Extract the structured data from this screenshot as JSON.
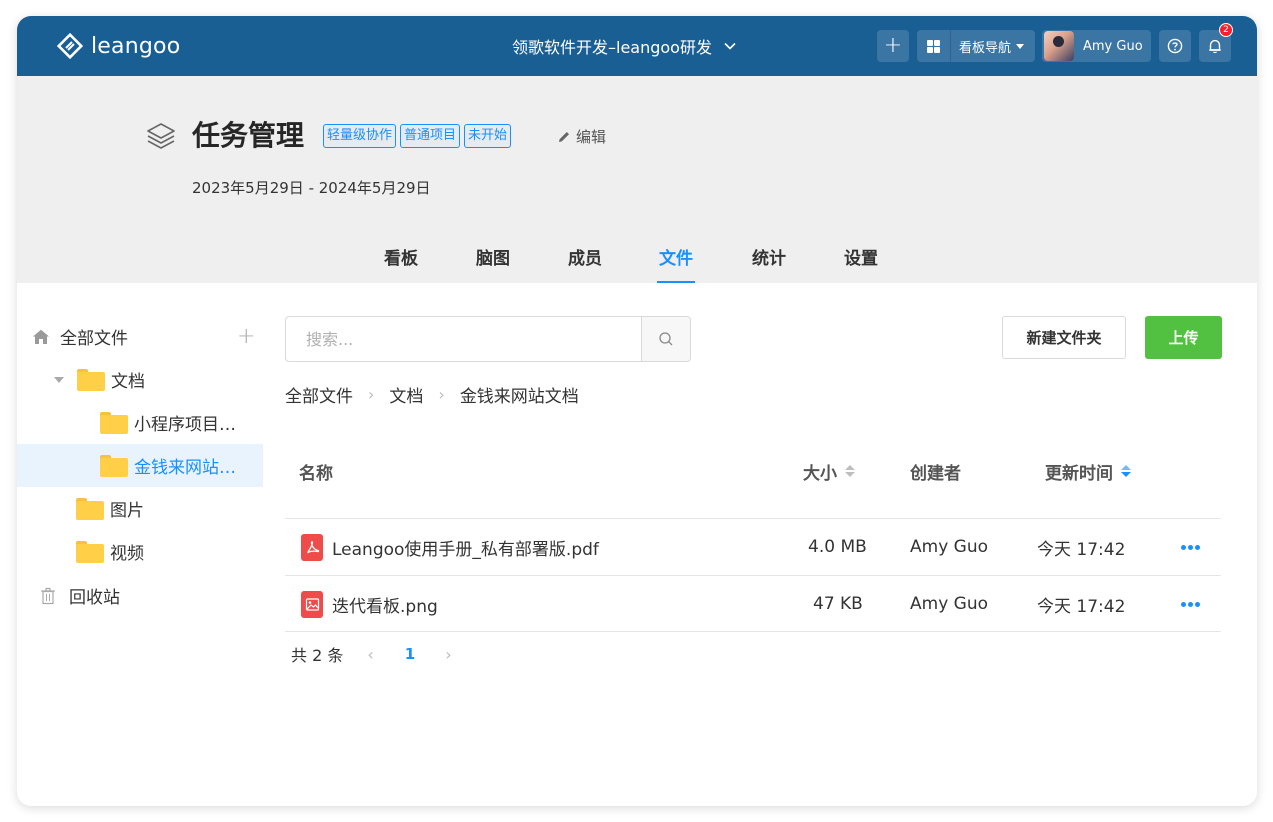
{
  "app": {
    "logo_text": "leangoo"
  },
  "topbar": {
    "project_title": "领歌软件开发–leangoo研发",
    "board_nav_label": "看板导航",
    "user_name": "Amy Guo",
    "notification_count": "2"
  },
  "project": {
    "title": "任务管理",
    "tags": [
      "轻量级协作",
      "普通项目",
      "未开始"
    ],
    "edit_label": "编辑",
    "date_range": "2023年5月29日 - 2024年5月29日"
  },
  "tabs": [
    {
      "label": "看板"
    },
    {
      "label": "脑图"
    },
    {
      "label": "成员"
    },
    {
      "label": "文件",
      "active": true
    },
    {
      "label": "统计"
    },
    {
      "label": "设置"
    }
  ],
  "sidebar": {
    "items": [
      {
        "label": "全部文件"
      },
      {
        "label": "文档"
      },
      {
        "label": "小程序项目…"
      },
      {
        "label": "金钱来网站…",
        "active": true
      },
      {
        "label": "图片"
      },
      {
        "label": "视频"
      },
      {
        "label": "回收站"
      }
    ]
  },
  "search": {
    "placeholder": "搜索..."
  },
  "actions": {
    "new_folder": "新建文件夹",
    "upload": "上传"
  },
  "breadcrumb": [
    "全部文件",
    "文档",
    "金钱来网站文档"
  ],
  "table": {
    "headers": {
      "name": "名称",
      "size": "大小",
      "creator": "创建者",
      "updated": "更新时间"
    },
    "rows": [
      {
        "icon": "pdf-file-icon",
        "name": "Leangoo使用手册_私有部署版.pdf",
        "size": "4.0 MB",
        "creator": "Amy Guo",
        "updated": "今天 17:42"
      },
      {
        "icon": "image-file-icon",
        "name": "迭代看板.png",
        "size": "47 KB",
        "creator": "Amy Guo",
        "updated": "今天 17:42"
      }
    ]
  },
  "pagination": {
    "total_label": "共 2 条",
    "current_page": "1"
  },
  "colors": {
    "topbar": "#1a5f94",
    "accent": "#1890ff",
    "upload": "#52c041",
    "file_icon": "#f04b4b"
  }
}
